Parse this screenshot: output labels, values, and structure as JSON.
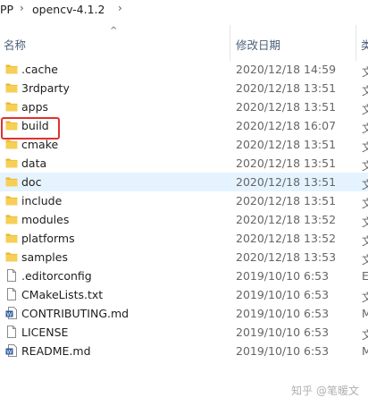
{
  "breadcrumb": {
    "items": [
      "PP",
      "opencv-4.1.2"
    ],
    "separator": "›"
  },
  "columns": {
    "name": "名称",
    "date": "修改日期",
    "type": "类"
  },
  "rows": [
    {
      "name": ".cache",
      "date": "2020/12/18 14:59",
      "type": "文",
      "kind": "folder"
    },
    {
      "name": "3rdparty",
      "date": "2020/12/18 13:51",
      "type": "文",
      "kind": "folder"
    },
    {
      "name": "apps",
      "date": "2020/12/18 13:51",
      "type": "文",
      "kind": "folder"
    },
    {
      "name": "build",
      "date": "2020/12/18 16:07",
      "type": "文",
      "kind": "folder"
    },
    {
      "name": "cmake",
      "date": "2020/12/18 13:51",
      "type": "文",
      "kind": "folder"
    },
    {
      "name": "data",
      "date": "2020/12/18 13:51",
      "type": "文",
      "kind": "folder"
    },
    {
      "name": "doc",
      "date": "2020/12/18 13:51",
      "type": "文",
      "kind": "folder"
    },
    {
      "name": "include",
      "date": "2020/12/18 13:51",
      "type": "文",
      "kind": "folder"
    },
    {
      "name": "modules",
      "date": "2020/12/18 13:52",
      "type": "文",
      "kind": "folder"
    },
    {
      "name": "platforms",
      "date": "2020/12/18 13:52",
      "type": "文",
      "kind": "folder"
    },
    {
      "name": "samples",
      "date": "2020/12/18 13:53",
      "type": "文",
      "kind": "folder"
    },
    {
      "name": ".editorconfig",
      "date": "2019/10/10 6:53",
      "type": "E",
      "kind": "file"
    },
    {
      "name": "CMakeLists.txt",
      "date": "2019/10/10 6:53",
      "type": "文",
      "kind": "file"
    },
    {
      "name": "CONTRIBUTING.md",
      "date": "2019/10/10 6:53",
      "type": "M",
      "kind": "doc"
    },
    {
      "name": "LICENSE",
      "date": "2019/10/10 6:53",
      "type": "文",
      "kind": "file"
    },
    {
      "name": "README.md",
      "date": "2019/10/10 6:53",
      "type": "M",
      "kind": "doc"
    }
  ],
  "selected_index": 6,
  "highlight_index": 3,
  "watermark": "知乎 @笔暖文"
}
